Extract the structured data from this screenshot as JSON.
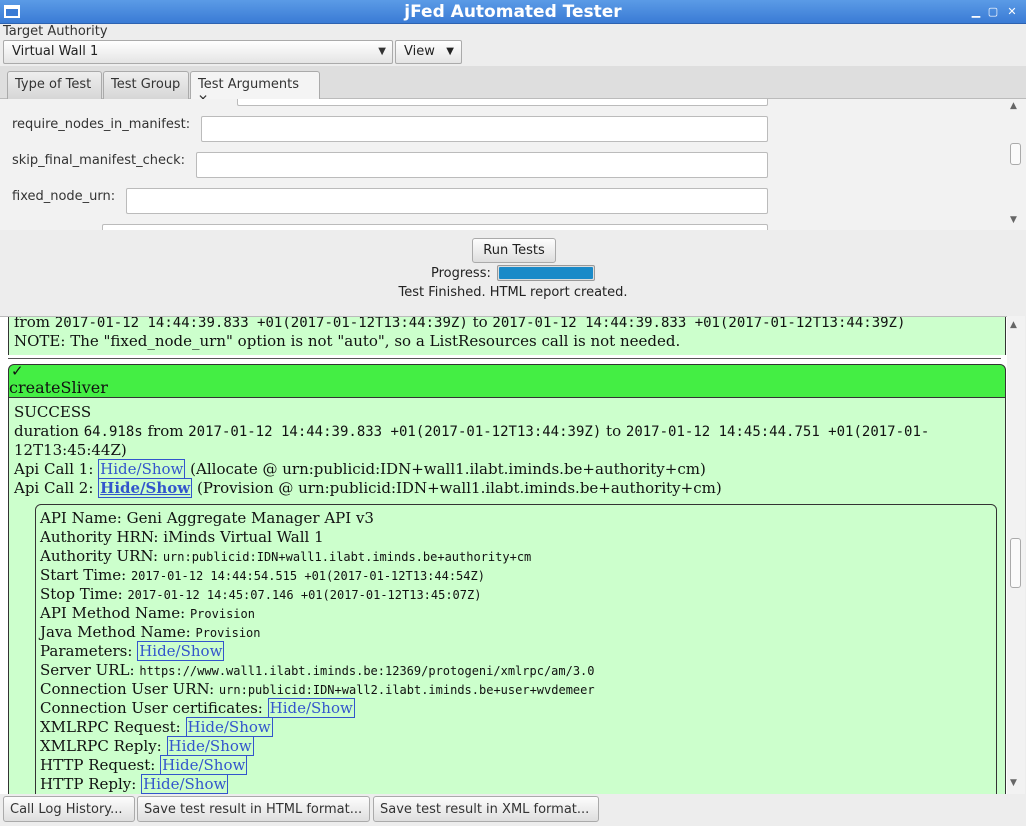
{
  "window": {
    "title": "jFed Automated Tester"
  },
  "target": {
    "label": "Target Authority",
    "selected": "Virtual Wall 1",
    "view_label": "View"
  },
  "tabs": [
    {
      "label": "Type of Test"
    },
    {
      "label": "Test Group"
    },
    {
      "label": "Test Arguments",
      "close": "✕"
    }
  ],
  "args": [
    {
      "label": "require_nodes_in_manifest:",
      "value": ""
    },
    {
      "label": "skip_final_manifest_check:",
      "value": ""
    },
    {
      "label": "fixed_node_urn:",
      "value": ""
    }
  ],
  "run": {
    "button": "Run Tests",
    "progress_label": "Progress:",
    "progress": 1.0,
    "status": "Test Finished. HTML report created."
  },
  "report": {
    "prev_line1_from": "from",
    "prev_line1_a": "2017-01-12 14:44:39.833 +01(2017-01-12T13:44:39Z)",
    "prev_line1_to": "to",
    "prev_line1_b": "2017-01-12 14:44:39.833 +01(2017-01-12T13:44:39Z)",
    "prev_note": "NOTE: The \"fixed_node_urn\" option is not \"auto\", so a ListResources call is not needed.",
    "check": "✓",
    "section_title": "createSliver",
    "result": "SUCCESS",
    "duration_label": "duration",
    "duration_value": "64.918s",
    "from_label": "from",
    "start": "2017-01-12 14:44:39.833 +01(2017-01-12T13:44:39Z)",
    "to_label": "to",
    "end_a": "2017-01-12 14:45:44.751 +01(2017-01-",
    "end_b": "12T13:45:44Z)",
    "api1_label": "Api Call 1:",
    "api1_link": "Hide/Show",
    "api1_desc": "(Allocate @ urn:publicid:IDN+wall1.ilabt.iminds.be+authority+cm)",
    "api2_label": "Api Call 2:",
    "api2_link": "Hide/Show",
    "api2_desc": "(Provision @ urn:publicid:IDN+wall1.ilabt.iminds.be+authority+cm)",
    "details": {
      "api_name_label": "API Name:",
      "api_name": "Geni Aggregate Manager API v3",
      "auth_hrn_label": "Authority HRN:",
      "auth_hrn": "iMinds Virtual Wall 1",
      "auth_urn_label": "Authority URN:",
      "auth_urn": "urn:publicid:IDN+wall1.ilabt.iminds.be+authority+cm",
      "start_label": "Start Time:",
      "start": "2017-01-12 14:44:54.515 +01(2017-01-12T13:44:54Z)",
      "stop_label": "Stop Time:",
      "stop": "2017-01-12 14:45:07.146 +01(2017-01-12T13:45:07Z)",
      "api_method_label": "API Method Name:",
      "api_method": "Provision",
      "java_method_label": "Java Method Name:",
      "java_method": "Provision",
      "params_label": "Parameters:",
      "params_link": "Hide/Show",
      "server_label": "Server URL:",
      "server": "https://www.wall1.ilabt.iminds.be:12369/protogeni/xmlrpc/am/3.0",
      "conn_user_label": "Connection User URN:",
      "conn_user": "urn:publicid:IDN+wall2.ilabt.iminds.be+user+wvdemeer",
      "certs_label": "Connection User certificates:",
      "certs_link": "Hide/Show",
      "xmlreq_label": "XMLRPC Request:",
      "xmlreq_link": "Hide/Show",
      "xmlrep_label": "XMLRPC Reply:",
      "xmlrep_link": "Hide/Show",
      "httpreq_label": "HTTP Request:",
      "httpreq_link": "Hide/Show",
      "httprep_label": "HTTP Reply:",
      "httprep_link": "Hide/Show"
    }
  },
  "bottom": {
    "call_log": "Call Log History...",
    "save_html": "Save test result in HTML format...",
    "save_xml": "Save test result in XML format..."
  }
}
